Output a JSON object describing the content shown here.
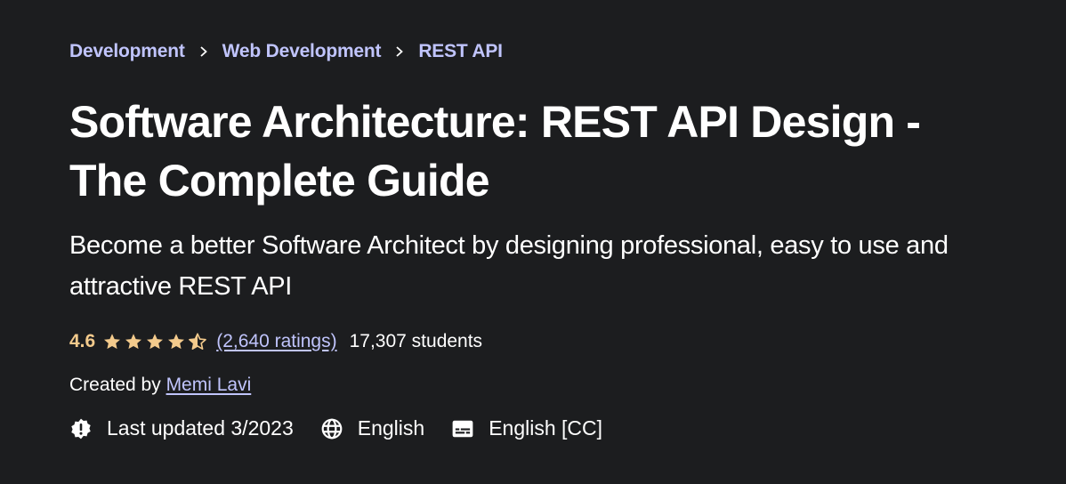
{
  "breadcrumb": {
    "items": [
      "Development",
      "Web Development",
      "REST API"
    ]
  },
  "course": {
    "title": "Software Architecture: REST API Design - The Complete Guide",
    "subtitle": "Become a better Software Architect by designing professional, easy to use and attractive REST API",
    "rating": {
      "value": "4.6",
      "stars_filled": 4.5,
      "stars_total": 5,
      "ratings_label": "(2,640 ratings)"
    },
    "students": "17,307 students",
    "created_by_label": "Created by",
    "instructor": "Memi Lavi",
    "last_updated": "Last updated 3/2023",
    "language": "English",
    "captions": "English [CC]"
  },
  "icons": {
    "breadcrumb_separator": "chevron-right-icon",
    "last_updated": "alert-badge-icon",
    "language": "globe-icon",
    "captions": "closed-captions-icon",
    "rating": "star-icon"
  },
  "colors": {
    "background": "#1c1d1f",
    "link": "#c0c4fc",
    "rating": "#f3ca8c",
    "text": "#ffffff"
  }
}
